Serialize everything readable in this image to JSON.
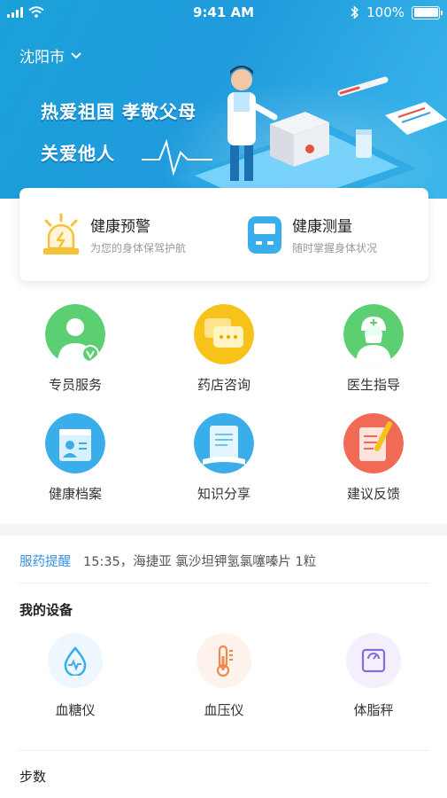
{
  "status_bar": {
    "time": "9:41 AM",
    "battery": "100%"
  },
  "banner": {
    "city": "沈阳市",
    "slogan_line1": "热爱祖国  孝敬父母",
    "slogan_line2": "关爱他人"
  },
  "health_card": {
    "items": [
      {
        "title": "健康预警",
        "subtitle": "为您的身体保驾护航",
        "icon": "alarm-light-icon"
      },
      {
        "title": "健康测量",
        "subtitle": "随时掌握身体状况",
        "icon": "measuring-device-icon"
      }
    ]
  },
  "services": [
    {
      "label": "专员服务",
      "icon": "staff-icon"
    },
    {
      "label": "药店咨询",
      "icon": "chat-icon"
    },
    {
      "label": "医生指导",
      "icon": "doctor-icon"
    },
    {
      "label": "健康档案",
      "icon": "profile-card-icon"
    },
    {
      "label": "知识分享",
      "icon": "book-icon"
    },
    {
      "label": "建议反馈",
      "icon": "feedback-icon"
    }
  ],
  "medication_reminder": {
    "label": "服药提醒",
    "text": "15:35，海捷亚 氯沙坦钾氢氯噻嗪片  1粒"
  },
  "my_devices": {
    "title": "我的设备",
    "items": [
      {
        "label": "血糖仪",
        "icon": "glucose-drop-icon"
      },
      {
        "label": "血压仪",
        "icon": "thermometer-icon"
      },
      {
        "label": "体脂秤",
        "icon": "scale-icon"
      }
    ]
  },
  "steps": {
    "title": "步数"
  },
  "colors": {
    "banner": "#1f9bdc",
    "accent": "#3a8fe8"
  }
}
